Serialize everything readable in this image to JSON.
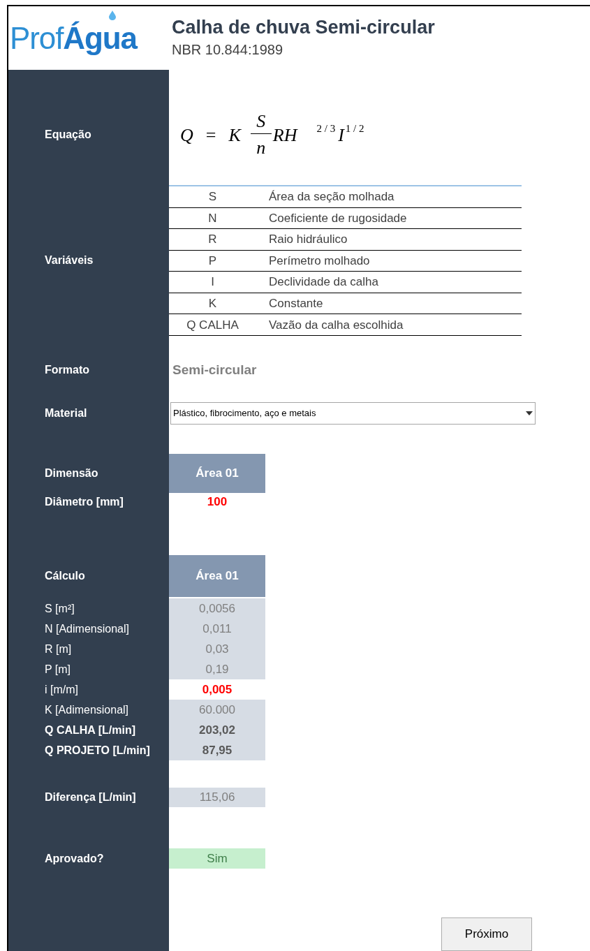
{
  "logo": {
    "part_1": "Prof",
    "part_2": "Água"
  },
  "header": {
    "title": "Calha de chuva Semi-circular",
    "subtitle": "NBR 10.844:1989"
  },
  "equation": {
    "label": "Equação",
    "lhs": "Q",
    "eq": "=",
    "k": "K",
    "numerator": "S",
    "denominator": "n",
    "rh": "RH",
    "rh_exp": "2 / 3",
    "i": "I",
    "i_exp": "1 / 2"
  },
  "variables": {
    "label": "Variáveis",
    "rows": [
      {
        "symbol": "S",
        "description": "Área da seção molhada"
      },
      {
        "symbol": "N",
        "description": "Coeficiente de rugosidade"
      },
      {
        "symbol": "R",
        "description": "Raio hidráulico"
      },
      {
        "symbol": "P",
        "description": "Perímetro molhado"
      },
      {
        "symbol": "I",
        "description": "Declividade da calha"
      },
      {
        "symbol": "K",
        "description": "Constante"
      },
      {
        "symbol": "Q CALHA",
        "description": "Vazão da calha escolhida"
      }
    ]
  },
  "format": {
    "label": "Formato",
    "value": "Semi-circular"
  },
  "material": {
    "label": "Material",
    "value": "Plástico, fibrocimento, aço e metais"
  },
  "dimension": {
    "label": "Dimensão",
    "header": "Área 01",
    "diameter_label": "Diâmetro [mm]",
    "diameter": "100"
  },
  "calculation": {
    "label": "Cálculo",
    "header": "Área 01",
    "rows": [
      {
        "label": "S [m²]",
        "value": "0,0056",
        "kind": "computed"
      },
      {
        "label": "N [Adimensional]",
        "value": "0,011",
        "kind": "computed"
      },
      {
        "label": "R [m]",
        "value": "0,03",
        "kind": "computed"
      },
      {
        "label": "P [m]",
        "value": "0,19",
        "kind": "computed"
      },
      {
        "label": "i [m/m]",
        "value": "0,005",
        "kind": "input"
      },
      {
        "label": "K [Adimensional]",
        "value": "60.000",
        "kind": "computed"
      },
      {
        "label": "Q CALHA [L/min]",
        "value": "203,02",
        "kind": "result"
      },
      {
        "label": "Q PROJETO [L/min]",
        "value": "87,95",
        "kind": "result"
      }
    ]
  },
  "difference": {
    "label": "Diferença [L/min]",
    "value": "115,06"
  },
  "approval": {
    "label": "Aprovado?",
    "value": "Sim",
    "approved": true
  },
  "next_button": "Próximo"
}
